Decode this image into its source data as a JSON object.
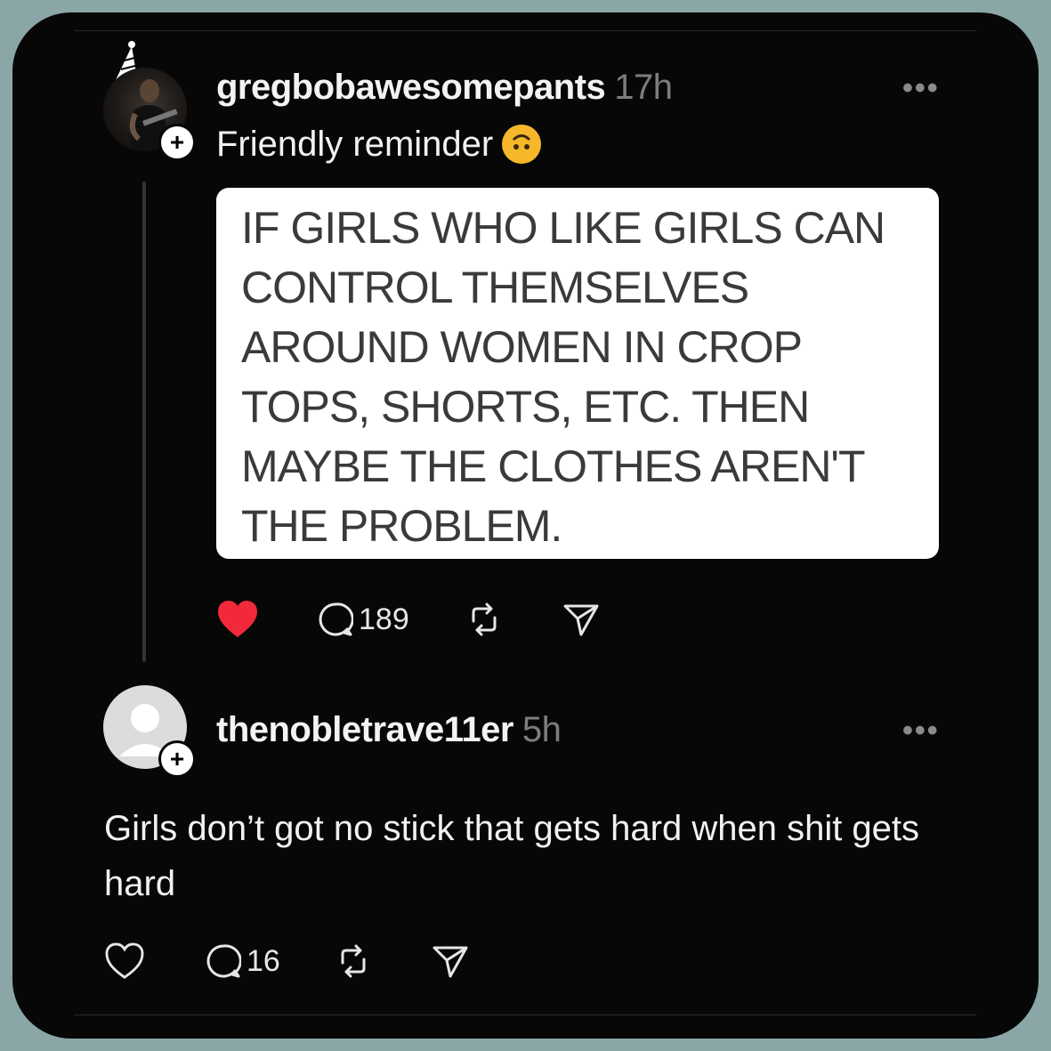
{
  "post": {
    "username": "gregbobawesomepants",
    "time": "17h",
    "more_label": "•••",
    "text": "Friendly reminder",
    "emoji": "upside-down-face-emoji",
    "follow_label": "+",
    "quote_lines": [
      "IF GIRLS WHO LIKE GIRLS CAN",
      "CONTROL THEMSELVES",
      "AROUND WOMEN IN CROP",
      "TOPS, SHORTS, ETC. THEN",
      "MAYBE THE CLOTHES AREN'T",
      "THE PROBLEM."
    ],
    "liked": true,
    "reply_count": "189"
  },
  "reply": {
    "username": "thenobletrave11er",
    "time": "5h",
    "more_label": "•••",
    "follow_label": "+",
    "text": "Girls don’t got no stick that gets hard when shit gets hard",
    "liked": false,
    "reply_count": "16"
  },
  "colors": {
    "background": "#8aa6a6",
    "card": "#070707",
    "like_active": "#f2293a",
    "text": "#f1f1f1",
    "muted": "#7d7d7d"
  }
}
